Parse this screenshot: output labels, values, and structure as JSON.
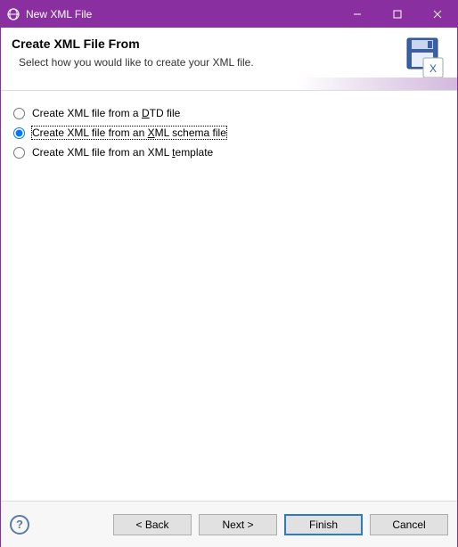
{
  "window": {
    "title": "New XML File"
  },
  "header": {
    "title": "Create XML File From",
    "subtitle": "Select how you would like to create your XML file."
  },
  "options": [
    {
      "label_pre": "Create XML file from a ",
      "mnemonic": "D",
      "label_post": "TD file",
      "selected": false
    },
    {
      "label_pre": "Create XML file from an ",
      "mnemonic": "X",
      "label_post": "ML schema file",
      "selected": true
    },
    {
      "label_pre": "Create XML file from an XML ",
      "mnemonic": "t",
      "label_post": "emplate",
      "selected": false
    }
  ],
  "buttons": {
    "back": "< Back",
    "next": "Next >",
    "finish": "Finish",
    "cancel": "Cancel"
  }
}
